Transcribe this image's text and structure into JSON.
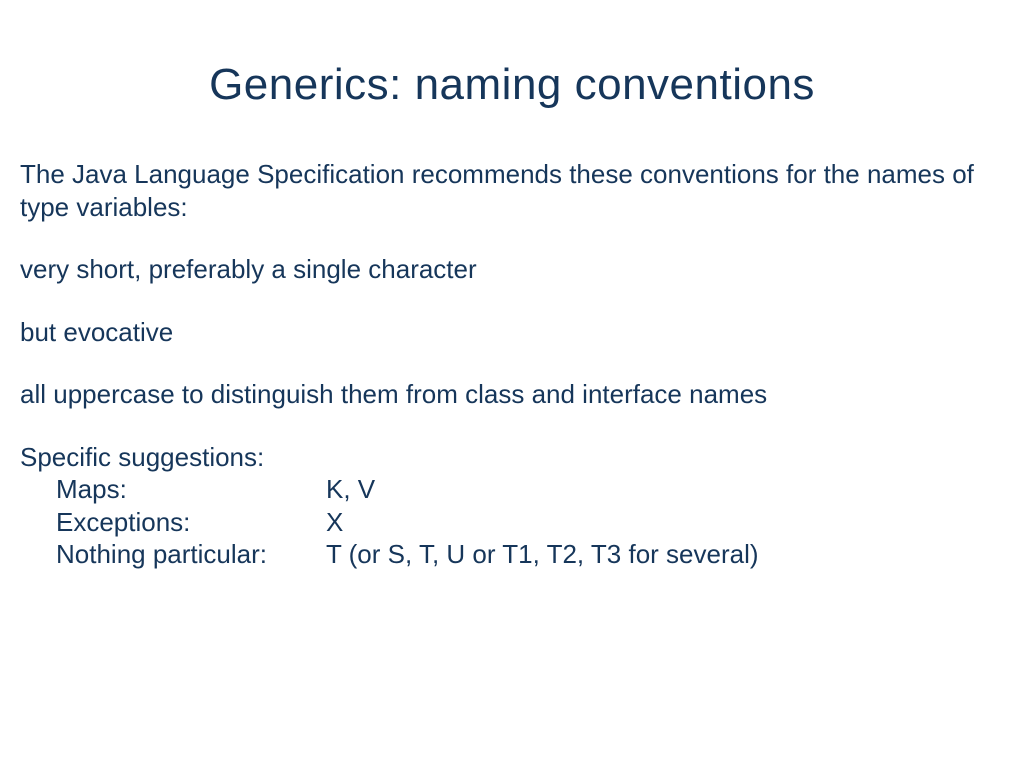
{
  "slide": {
    "title": "Generics: naming conventions",
    "intro": "The Java Language Specification recommends these conventions for the names of type variables:",
    "point1": "very short, preferably a single character",
    "point2": "but evocative",
    "point3": "all uppercase to distinguish them from class and interface names",
    "suggestions": {
      "heading": "Specific suggestions:",
      "rows": [
        {
          "label": "Maps:",
          "value": "K, V"
        },
        {
          "label": "Exceptions:",
          "value": "X"
        },
        {
          "label": "Nothing particular:",
          "value": "T (or S, T, U or T1, T2, T3 for several)"
        }
      ]
    }
  }
}
